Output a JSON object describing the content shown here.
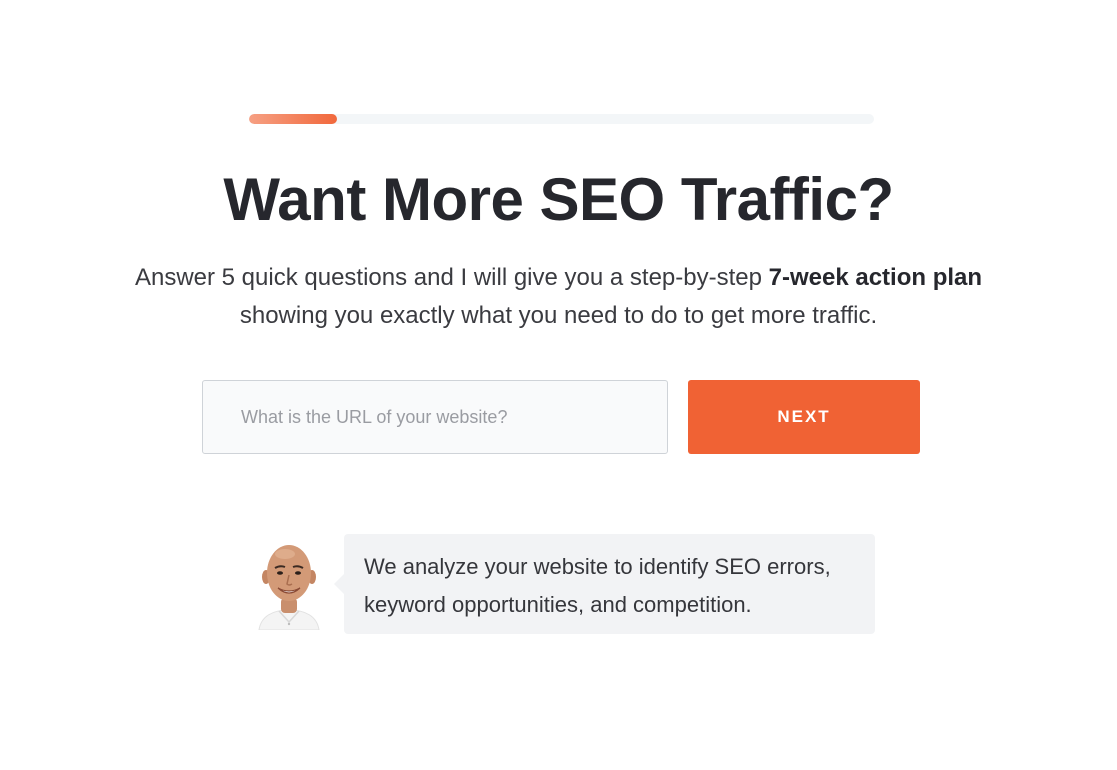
{
  "progress": {
    "fraction": 0.14,
    "fill_color_start": "#f6a083",
    "fill_color_end": "#f1683c",
    "track_color": "#f3f6f8"
  },
  "hero": {
    "title": "Want More SEO Traffic?",
    "subtitle_part1": "Answer 5 quick questions and I will give you a step-by-step ",
    "subtitle_bold": "7-week action plan",
    "subtitle_part2": " showing you exactly what you need to do to get more traffic."
  },
  "form": {
    "url_placeholder": "What is the URL of your website?",
    "url_value": "",
    "next_label": "NEXT",
    "accent_color": "#f06234"
  },
  "testimonial": {
    "avatar_icon": "person-avatar-icon",
    "message": "We analyze your website to identify SEO errors, keyword opportunities, and competition."
  }
}
